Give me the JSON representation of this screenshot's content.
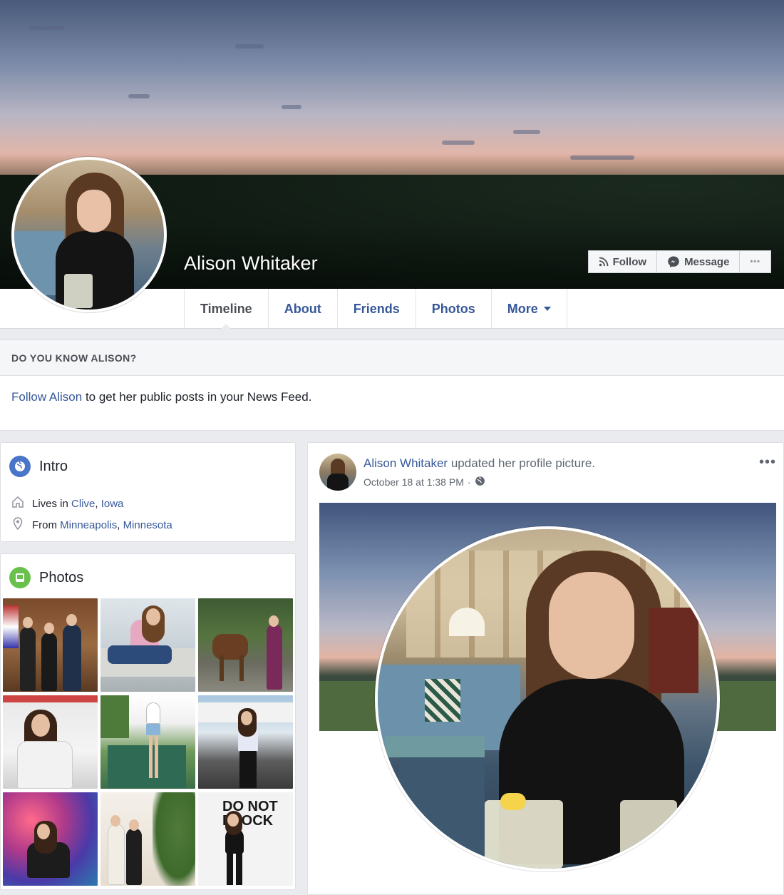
{
  "profile": {
    "name": "Alison Whitaker"
  },
  "actions": {
    "follow_label": "Follow",
    "message_label": "Message",
    "more_label": "•••"
  },
  "tabs": [
    {
      "label": "Timeline",
      "active": true
    },
    {
      "label": "About"
    },
    {
      "label": "Friends"
    },
    {
      "label": "Photos"
    },
    {
      "label": "More"
    }
  ],
  "know": {
    "heading": "DO YOU KNOW ALISON?",
    "link": "Follow Alison",
    "text": " to get her public posts in your News Feed."
  },
  "intro": {
    "title": "Intro",
    "lives_prefix": "Lives in ",
    "lives_city": "Clive",
    "lives_state": "Iowa",
    "from_prefix": "From ",
    "from_city": "Minneapolis",
    "from_state": "Minnesota"
  },
  "photos": {
    "title": "Photos",
    "overlay_text": "DO NOT\nBLOCK"
  },
  "post": {
    "author": "Alison Whitaker",
    "action": " updated her profile picture.",
    "date": "October 18 at 1:38 PM",
    "more": "•••"
  },
  "colors": {
    "link": "#365899",
    "background": "#e9ebee",
    "intro_icon": "#4a76c9",
    "photos_icon": "#69c14d"
  },
  "icons": [
    "rss-icon",
    "messenger-icon",
    "globe-icon",
    "home-icon",
    "location-pin-icon",
    "photo-icon",
    "caret-down-icon"
  ]
}
